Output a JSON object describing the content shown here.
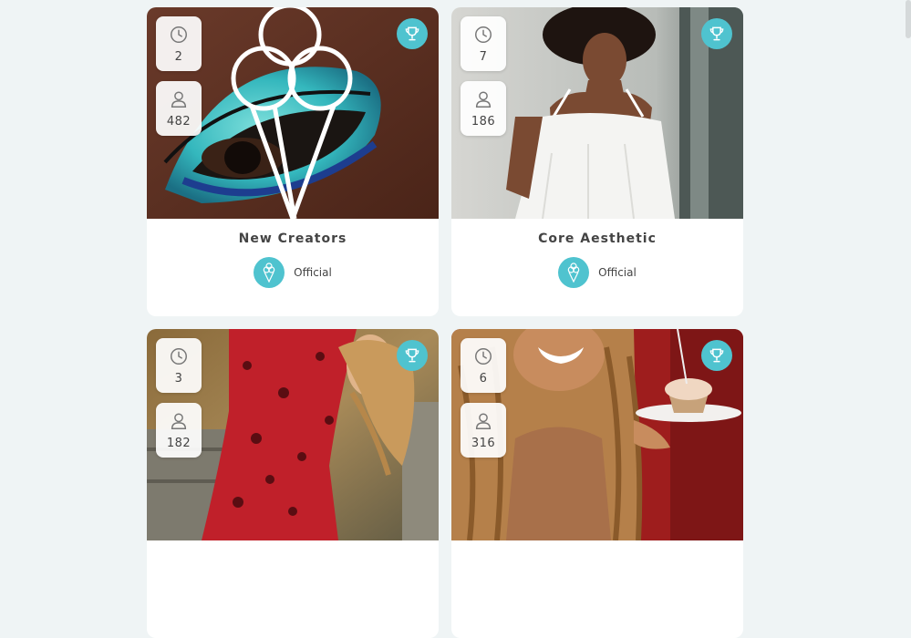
{
  "cards": [
    {
      "title": "New Creators",
      "days": "2",
      "members": "482",
      "owner": "Official"
    },
    {
      "title": "Core Aesthetic",
      "days": "7",
      "members": "186",
      "owner": "Official"
    },
    {
      "title": "",
      "days": "3",
      "members": "182",
      "owner": ""
    },
    {
      "title": "",
      "days": "6",
      "members": "316",
      "owner": ""
    }
  ],
  "icons": {
    "duration": "clock-icon",
    "members": "person-icon",
    "award": "trophy-icon",
    "brand": "ice-cream-icon"
  },
  "colors": {
    "accent": "#4fc3cf",
    "background": "#eff4f5",
    "card": "#ffffff",
    "text": "#444444"
  }
}
